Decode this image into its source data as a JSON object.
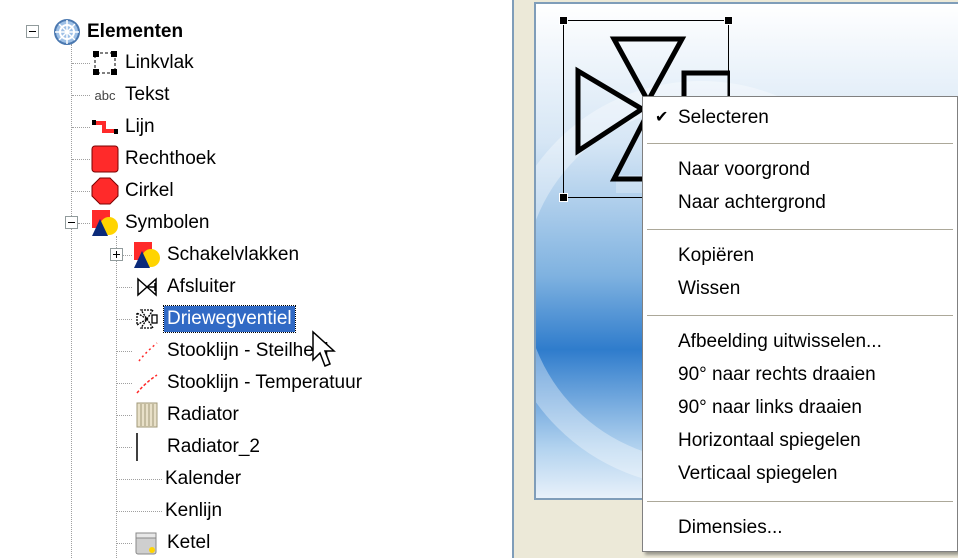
{
  "tree": {
    "root": {
      "label": "Elementen",
      "icon": "globe-icon"
    },
    "items": [
      {
        "label": "Linkvlak",
        "icon": "link-area-icon"
      },
      {
        "label": "Tekst",
        "icon": "text-abc-icon",
        "icon_text": "abc"
      },
      {
        "label": "Lijn",
        "icon": "line-icon"
      },
      {
        "label": "Rechthoek",
        "icon": "rectangle-icon"
      },
      {
        "label": "Cirkel",
        "icon": "circle-icon"
      },
      {
        "label": "Symbolen",
        "icon": "symbols-icon"
      }
    ],
    "symbols": [
      {
        "label": "Schakelvlakken",
        "icon": "symbols-icon"
      },
      {
        "label": "Afsluiter",
        "icon": "valve-icon"
      },
      {
        "label": "Driewegventiel",
        "icon": "three-way-valve-icon",
        "selected": true
      },
      {
        "label": "Stooklijn - Steilheid",
        "icon": "curve-icon"
      },
      {
        "label": "Stooklijn - Temperatuur",
        "icon": "curve-red-icon"
      },
      {
        "label": "Radiator",
        "icon": "radiator-icon"
      },
      {
        "label": "Radiator_2",
        "icon": "radiator-line-icon"
      },
      {
        "label": "Kalender",
        "icon": ""
      },
      {
        "label": "Kenlijn",
        "icon": ""
      },
      {
        "label": "Ketel",
        "icon": "boiler-icon"
      }
    ]
  },
  "menu": {
    "items": [
      {
        "label": "Selecteren",
        "checked": true
      },
      {
        "label": "Naar voorgrond"
      },
      {
        "label": "Naar achtergrond"
      },
      {
        "label": "Kopiëren"
      },
      {
        "label": "Wissen"
      },
      {
        "label": "Afbeelding uitwisselen..."
      },
      {
        "label": "90° naar rechts draaien"
      },
      {
        "label": "90° naar links draaien"
      },
      {
        "label": "Horizontaal spiegelen"
      },
      {
        "label": "Verticaal spiegelen"
      },
      {
        "label": "Dimensies..."
      }
    ]
  },
  "colors": {
    "selection": "#316ac5",
    "panel_border": "#7f9db9",
    "red_icon": "#ff2a2a"
  }
}
